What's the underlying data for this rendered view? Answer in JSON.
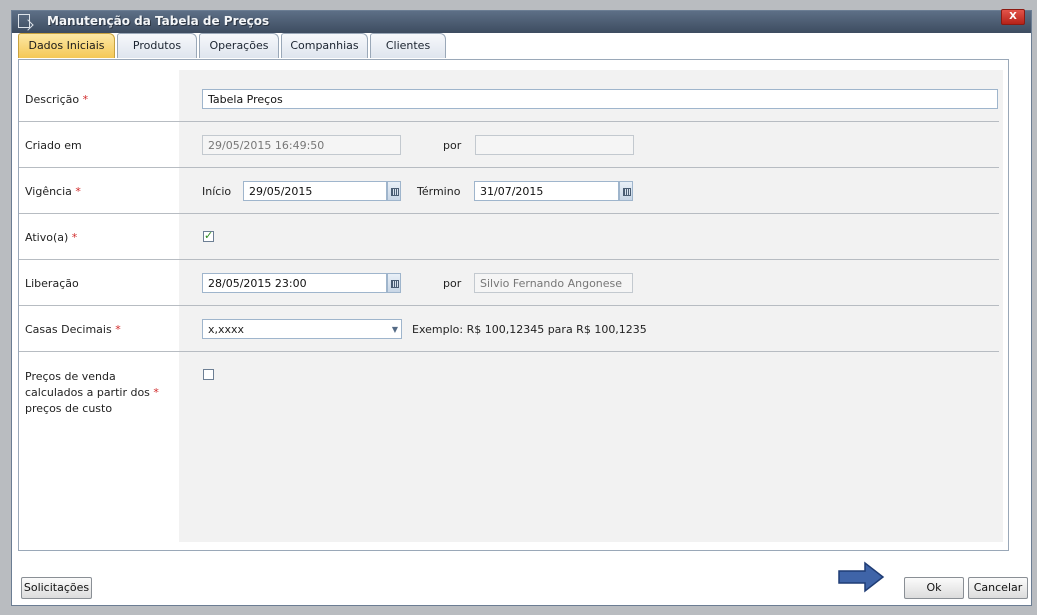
{
  "window": {
    "title": "Manutenção da Tabela de Preços",
    "close_label": "X"
  },
  "tabs": [
    {
      "label": "Dados Iniciais",
      "active": true
    },
    {
      "label": "Produtos",
      "active": false
    },
    {
      "label": "Operações",
      "active": false
    },
    {
      "label": "Companhias",
      "active": false
    },
    {
      "label": "Clientes",
      "active": false
    }
  ],
  "form": {
    "descricao": {
      "label": "Descrição",
      "required": "*",
      "value": "Tabela Preços"
    },
    "criado": {
      "label": "Criado em",
      "value": "29/05/2015 16:49:50",
      "por_label": "por",
      "por_value": ""
    },
    "vigencia": {
      "label": "Vigência",
      "required": "*",
      "inicio_label": "Início",
      "inicio_value": "29/05/2015",
      "termino_label": "Término",
      "termino_value": "31/07/2015"
    },
    "ativo": {
      "label": "Ativo(a)",
      "required": "*",
      "checked": true
    },
    "liberacao": {
      "label": "Liberação",
      "value": "28/05/2015 23:00",
      "por_label": "por",
      "por_value": "Silvio Fernando Angonese"
    },
    "casas": {
      "label": "Casas Decimais",
      "required": "*",
      "value": "x,xxxx",
      "exemplo": "Exemplo: R$ 100,12345 para R$ 100,1235"
    },
    "precos": {
      "label_line1": "Preços de venda",
      "label_line2": "calculados a partir dos",
      "label_line3": "preços de custo",
      "required": "*",
      "checked": false
    }
  },
  "footer": {
    "solicitacoes_label": "Solicitações",
    "ok_label": "Ok",
    "cancelar_label": "Cancelar"
  },
  "colors": {
    "accent_tab": "#f4c857",
    "required": "#d12a2a",
    "arrow": "#3f64a8"
  }
}
